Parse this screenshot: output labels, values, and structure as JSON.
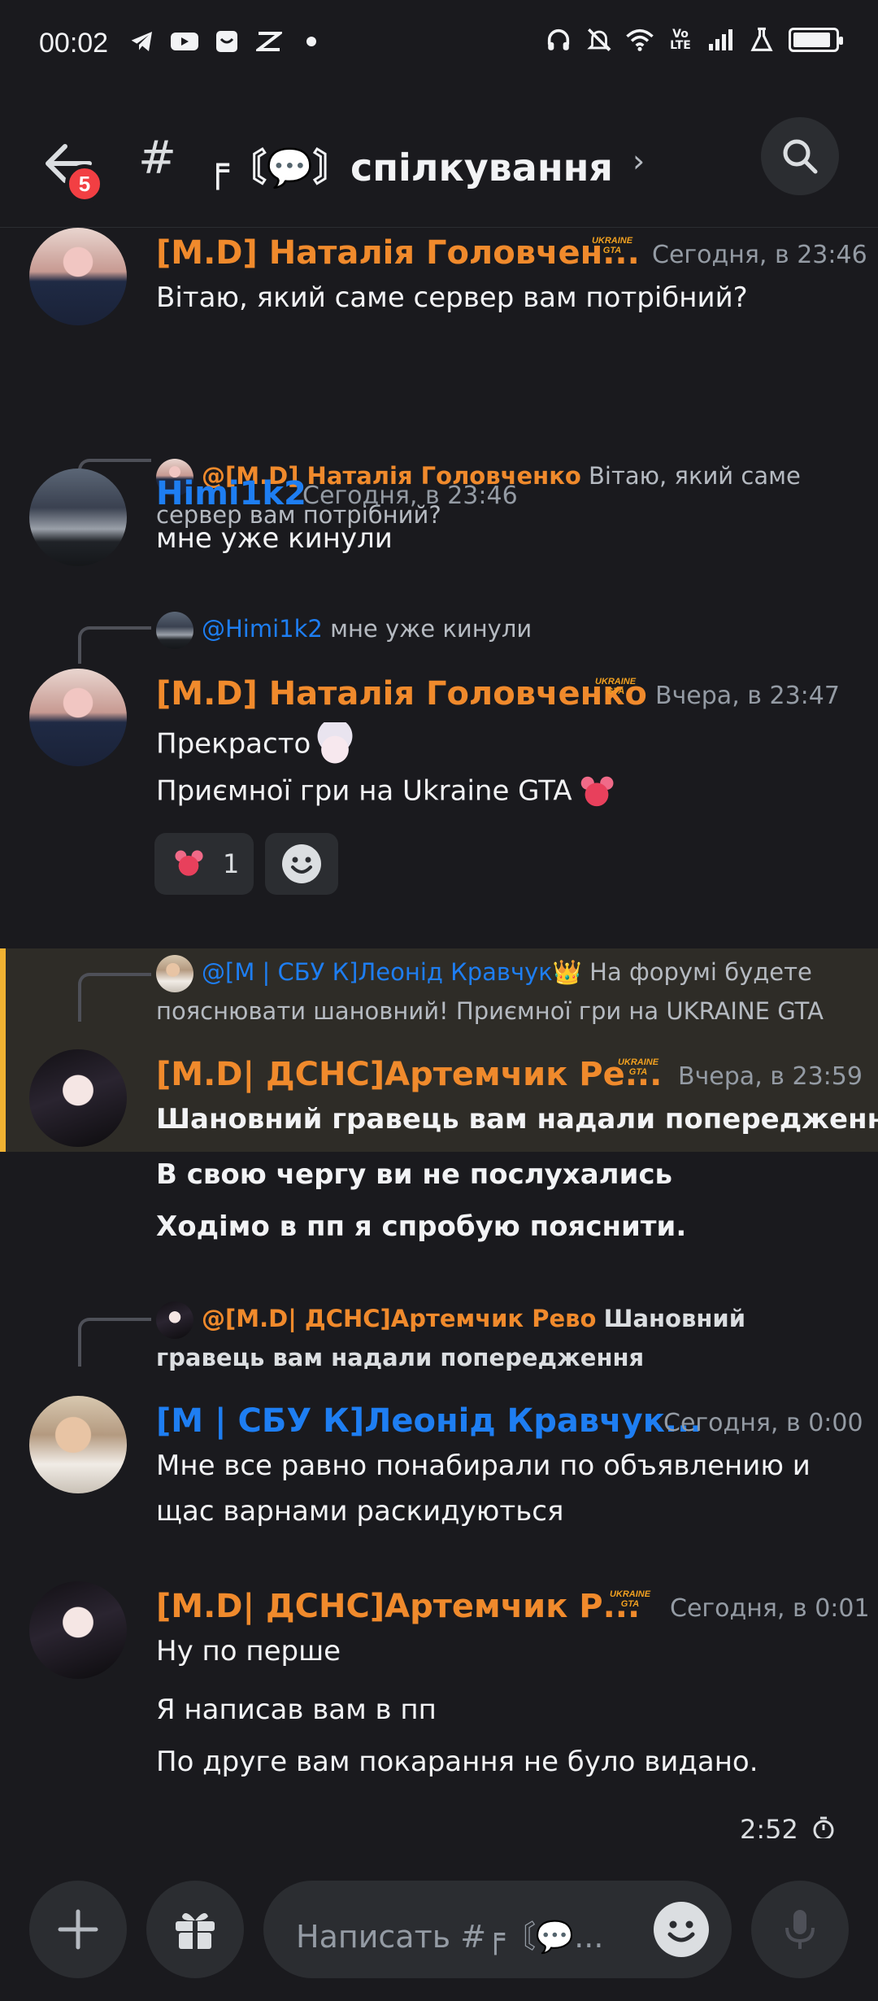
{
  "status_bar": {
    "time": "00:02",
    "icons_left": [
      "telegram-icon",
      "youtube-icon",
      "mail-icon",
      "capcut-icon",
      "dot-icon"
    ],
    "icons_right": [
      "headphones-icon",
      "mute-icon",
      "wifi-icon",
      "volte-icon",
      "signal-icon",
      "flask-icon",
      "battery-icon"
    ],
    "volte_label": "Vo LTE"
  },
  "header": {
    "unread_badge": "5",
    "hash": "#",
    "channel_name": "╒〘💬〙спілкування",
    "chevron": "›"
  },
  "messages": [
    {
      "author": "[M.D] Наталія Головчен...",
      "author_color": "#f08a2c",
      "role_tag": "UKRAINE GTA",
      "timestamp": "Сегодня, в 23:46",
      "lines": [
        "Вітаю, який саме сервер вам потрібний?"
      ]
    },
    {
      "reply": {
        "mention": "@[M.D] Наталія Головченко",
        "text": "Вітаю, який саме сервер вам потрібний?"
      },
      "author": "Himi1k2",
      "author_color": "#1e7ef2",
      "timestamp": "Сегодня, в 23:46",
      "lines": [
        "мне уже кинули"
      ]
    },
    {
      "reply": {
        "mention": "@Himi1k2",
        "text": "мне уже кинули"
      },
      "author": "[M.D] Наталія Головченко",
      "author_color": "#f08a2c",
      "role_tag": "UKRAINE GTA",
      "timestamp": "Вчера, в 23:47",
      "lines": [
        "Прекрасто",
        "Приємної гри на Ukraine GTA"
      ],
      "reactions": [
        {
          "emoji": "pink-creature",
          "count": "1"
        }
      ]
    },
    {
      "highlighted": true,
      "reply": {
        "mention": "@[M | СБУ К]Леонід Кравчук👑",
        "text": "На форумі будете пояснювати шановний! Приємної гри на UKRAINE GTA"
      },
      "author": "[M.D| ДСНС]Артемчик Ре...",
      "author_color": "#f08a2c",
      "role_tag": "UKRAINE GTA",
      "timestamp": "Вчера, в 23:59",
      "lines": [
        "Шановний гравець вам надали попередження",
        "В свою чергу ви не послухались",
        "Ходімо в пп я спробую пояснити."
      ]
    },
    {
      "reply": {
        "mention": "@[M.D| ДСНС]Артемчик Рево",
        "text": "Шановний гравець вам надали попередження"
      },
      "author": "[M | СБУ К]Леонід Кравчук...",
      "author_color": "#1e7ef2",
      "timestamp": "Сегодня, в 0:00",
      "lines": [
        "Мне все равно понабирали по объявлению и",
        "щас варнами раскидуються"
      ]
    },
    {
      "author": "[M.D| ДСНС]Артемчик Р...",
      "author_color": "#f08a2c",
      "role_tag": "UKRAINE GTA",
      "timestamp": "Сегодня, в 0:01",
      "lines": [
        "Ну по перше",
        "Я написав вам в пп",
        "По друге вам покарання не було видано."
      ]
    }
  ],
  "slowmode_timer": "2:52",
  "composer": {
    "placeholder": "Написать #╒〘💬...",
    "buttons": [
      "plus-icon",
      "gift-icon",
      "emoji-icon",
      "microphone-icon"
    ]
  }
}
